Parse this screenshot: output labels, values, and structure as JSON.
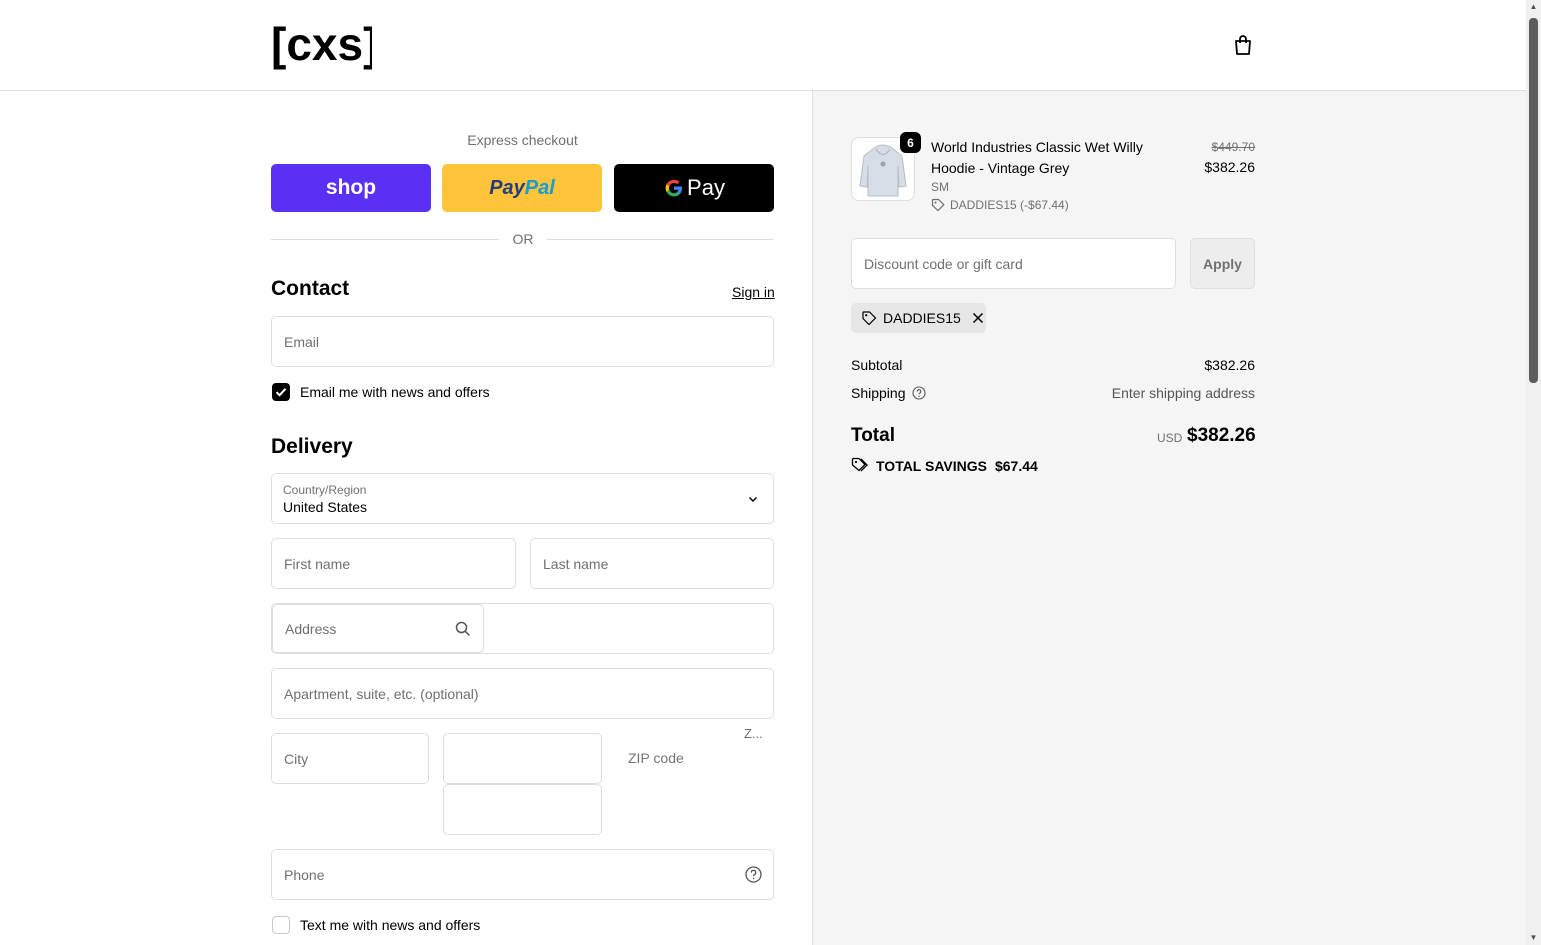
{
  "header": {
    "logo_text": "[cxs]",
    "cart_icon": "shopping-bag-icon"
  },
  "express": {
    "label": "Express checkout",
    "shop_label": "shop",
    "paypal_label_1": "Pay",
    "paypal_label_2": "Pal",
    "gpay_label": "Pay",
    "or_text": "OR"
  },
  "contact": {
    "title": "Contact",
    "sign_in": "Sign in",
    "email_placeholder": "Email",
    "news_checkbox_label": "Email me with news and offers",
    "news_checked": true
  },
  "delivery": {
    "title": "Delivery",
    "country_label": "Country/Region",
    "country_value": "United States",
    "first_name_placeholder": "First name",
    "last_name_placeholder": "Last name",
    "address_placeholder": "Address",
    "apartment_placeholder": "Apartment, suite, etc. (optional)",
    "city_placeholder": "City",
    "zip_placeholder": "ZIP code",
    "zip_truncated": "Z...",
    "phone_placeholder": "Phone",
    "text_checkbox_label": "Text me with news and offers",
    "text_checked": false
  },
  "summary": {
    "item": {
      "name": "World Industries Classic Wet Willy Hoodie - Vintage Grey",
      "variant": "SM",
      "quantity": "6",
      "discount": "DADDIES15 (-$67.44)",
      "price_original": "$449.70",
      "price_final": "$382.26"
    },
    "discount_placeholder": "Discount code or gift card",
    "apply_label": "Apply",
    "applied_code": "DADDIES15",
    "subtotal_label": "Subtotal",
    "subtotal_value": "$382.26",
    "shipping_label": "Shipping",
    "shipping_value": "Enter shipping address",
    "total_label": "Total",
    "total_currency": "USD",
    "total_value": "$382.26",
    "savings_label": "TOTAL SAVINGS",
    "savings_value": "$67.44"
  },
  "colors": {
    "shop": "#5a31f4",
    "paypal": "#ffc439",
    "gpay": "#000000",
    "sidebar_bg": "#f5f5f5"
  }
}
